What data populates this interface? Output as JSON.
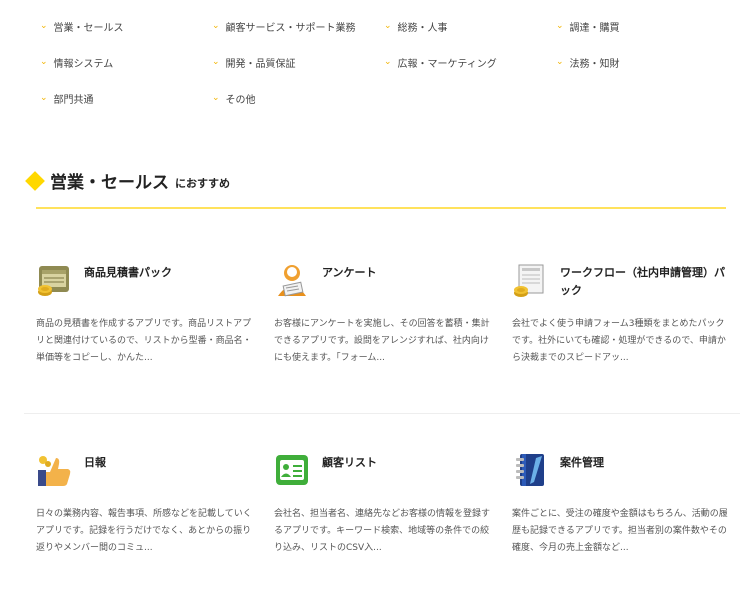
{
  "categories": [
    [
      "営業・セールス",
      "顧客サービス・サポート業務",
      "総務・人事",
      "調達・購買"
    ],
    [
      "情報システム",
      "開発・品質保証",
      "広報・マーケティング",
      "法務・知財"
    ],
    [
      "部門共通",
      "その他"
    ]
  ],
  "section": {
    "title": "営業・セールス",
    "suffix": "におすすめ"
  },
  "cards": [
    {
      "title": "商品見積書パック",
      "desc": "商品の見積書を作成するアプリです。商品リストアプリと関連付けているので、リストから型番・商品名・単価等をコピーし、かんた..."
    },
    {
      "title": "アンケート",
      "desc": "お客様にアンケートを実施し、その回答を蓄積・集計できるアプリです。設問をアレンジすれば、社内向けにも使えます。「フォーム..."
    },
    {
      "title": "ワークフロー（社内申請管理）パック",
      "desc": "会社でよく使う申請フォーム3種類をまとめたパックです。社外にいても確認・処理ができるので、申請から決裁までのスピードアッ..."
    },
    {
      "title": "日報",
      "desc": "日々の業務内容、報告事項、所感などを記載していくアプリです。記録を行うだけでなく、あとからの振り返りやメンバー間のコミュ..."
    },
    {
      "title": "顧客リスト",
      "desc": "会社名、担当者名、連絡先などお客様の情報を登録するアプリです。キーワード検索、地域等の条件での絞り込み、リストのCSV入..."
    },
    {
      "title": "案件管理",
      "desc": "案件ごとに、受注の確度や金額はもちろん、活動の履歴も記録できるアプリです。担当者別の案件数やその確度、今月の売上金額など..."
    }
  ],
  "colors": {
    "accent": "#ffd800",
    "chevron": "#f2b400",
    "rule": "#ffe25c"
  },
  "icons": [
    "coins-invoice-icon",
    "person-survey-icon",
    "document-coins-icon",
    "thumbs-up-icon",
    "contact-card-icon",
    "notebook-icon"
  ]
}
